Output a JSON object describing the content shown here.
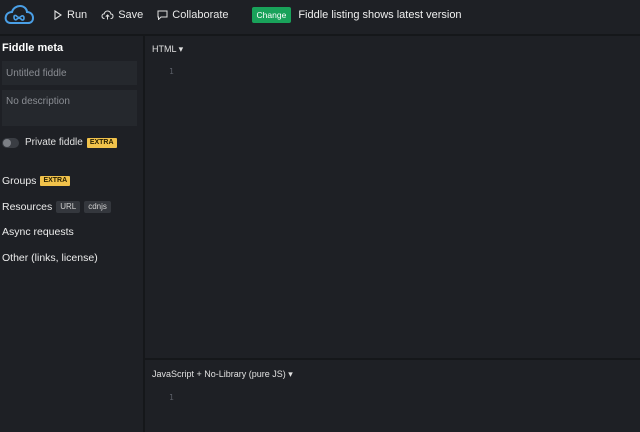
{
  "toolbar": {
    "run_label": "Run",
    "save_label": "Save",
    "collaborate_label": "Collaborate",
    "change_badge": "Change",
    "notice": "Fiddle listing shows latest version"
  },
  "sidebar": {
    "title": "Fiddle meta",
    "title_placeholder": "Untitled fiddle",
    "description_placeholder": "No description",
    "private_label": "Private fiddle",
    "private_badge": "EXTRA",
    "groups_label": "Groups",
    "groups_badge": "EXTRA",
    "resources_label": "Resources",
    "resources_tags": [
      "URL",
      "cdnjs"
    ],
    "async_label": "Async requests",
    "other_label": "Other (links, license)"
  },
  "editors": {
    "html_label": "HTML ▾",
    "html_line": "1",
    "js_label": "JavaScript + No-Library (pure JS) ▾",
    "js_line": "1"
  },
  "colors": {
    "accent_logo": "#4a9fe6",
    "change_badge": "#19a25a",
    "extra_badge": "#f1c24b",
    "background": "#1e2025"
  }
}
